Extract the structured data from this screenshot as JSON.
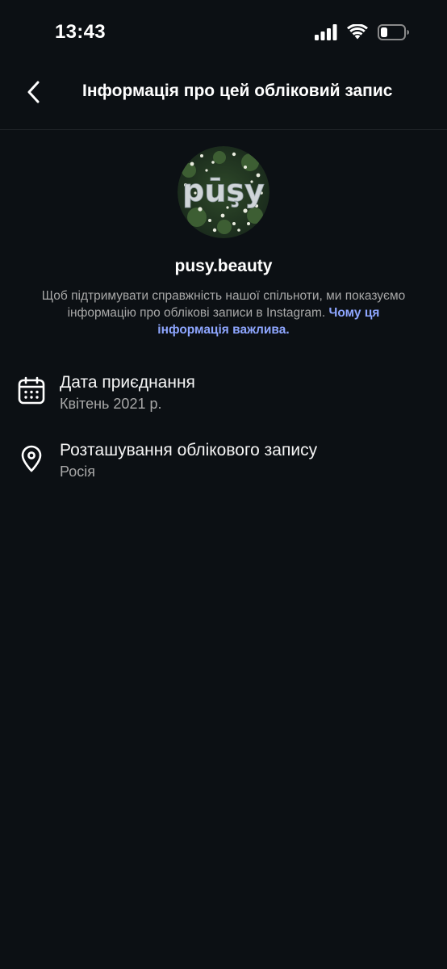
{
  "status_bar": {
    "time": "13:43",
    "icons": [
      "signal-icon",
      "wifi-icon",
      "battery-icon"
    ]
  },
  "header": {
    "back_icon": "chevron-left-icon",
    "title": "Інформація про цей обліковий запис"
  },
  "profile": {
    "avatar_text": "pūşy",
    "username": "pusy.beauty",
    "description": "Щоб підтримувати справжність нашої спільноти, ми показуємо інформацію про облікові записи в Instagram.",
    "link": "Чому ця інформація важлива."
  },
  "rows": [
    {
      "icon": "calendar-icon",
      "title": "Дата приєднання",
      "subtitle": "Квітень 2021 р."
    },
    {
      "icon": "location-pin-icon",
      "title": "Розташування облікового запису",
      "subtitle": "Росія"
    }
  ],
  "colors": {
    "background": "#0c1014",
    "link": "#8ea6ff",
    "secondary_text": "#a8a8a8"
  }
}
